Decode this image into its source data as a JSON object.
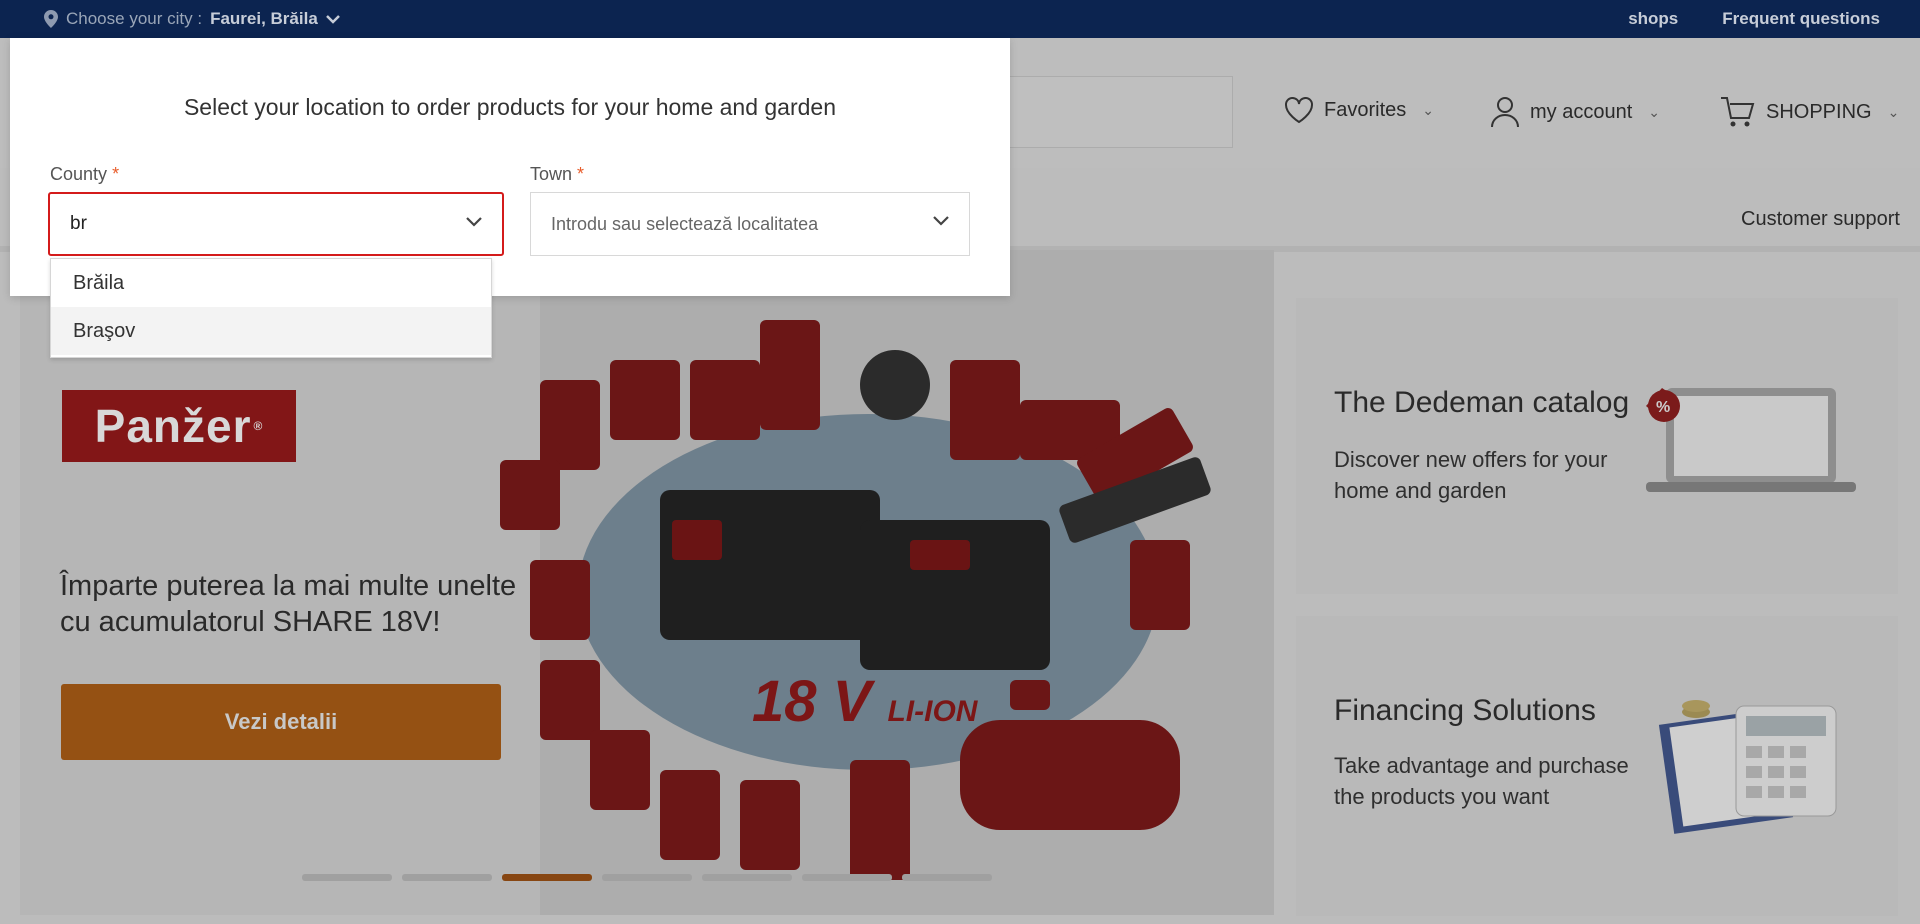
{
  "topbar": {
    "city_prefix": "Choose your city :",
    "city_value": "Faurei, Brăila",
    "links": [
      "shops",
      "Frequent questions"
    ]
  },
  "header": {
    "favorites": "Favorites",
    "account": "my account",
    "cart": "SHOPPING",
    "support": "Customer support"
  },
  "modal": {
    "title": "Select your location to order products for your home and garden",
    "county_label": "County",
    "town_label": "Town",
    "required_mark": "*",
    "county_value": "br",
    "town_placeholder": "Introdu sau selectează localitatea",
    "options": [
      "Brăila",
      "Braşov"
    ]
  },
  "banner": {
    "brand": "Panžer",
    "text": "Împarte puterea la mai multe unelte cu acumulatorul SHARE 18V!",
    "cta": "Vezi detalii",
    "voltage": "18 V",
    "voltage_suffix": "LI-ION",
    "slides": 7,
    "active_slide": 3
  },
  "cards": [
    {
      "title": "The Dedeman catalog",
      "text": "Discover new offers for your home and garden"
    },
    {
      "title": "Financing Solutions",
      "text": "Take advantage and purchase the products you want"
    }
  ],
  "colors": {
    "topbar": "#0c2450",
    "accent": "#e85c2a",
    "active_border": "#d41b1b"
  }
}
